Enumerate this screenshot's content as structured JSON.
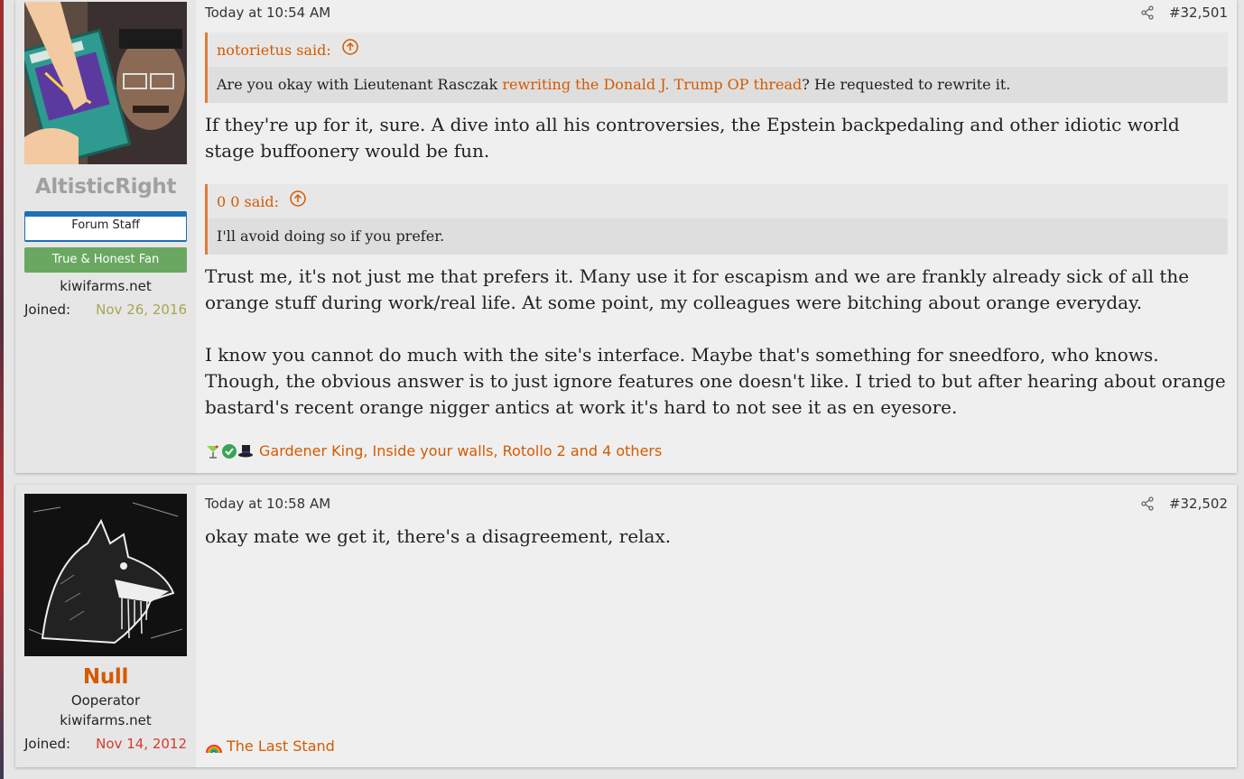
{
  "posts": [
    {
      "username": "AltisticRight",
      "banners": [
        "Forum Staff",
        "True & Honest Fan"
      ],
      "site": "kiwifarms.net",
      "joined_label": "Joined:",
      "joined_date": "Nov 26, 2016",
      "timestamp": "Today at 10:54 AM",
      "post_number": "#32,501",
      "quotes": [
        {
          "author": "notorietus said:",
          "text_before": "Are you okay with Lieutenant Rasczak ",
          "link": "rewriting the Donald J. Trump OP thread",
          "text_after": "? He requested to rewrite it."
        },
        {
          "author": "0 0 said:",
          "text": "I'll avoid doing so if you prefer."
        }
      ],
      "reply1": "If they're up for it, sure. A dive into all his controversies, the Epstein backpedaling and other idiotic world stage buffoonery would be fun.",
      "reply2": "Trust me, it's not just me that prefers it. Many use it for escapism and we are frankly already sick of all the orange stuff during work/real life. At some point, my colleagues were bitching about orange everyday.",
      "reply3": "I know you cannot do much with the site's interface. Maybe that's something for sneedforo, who knows. Though, the obvious answer is to just ignore features one doesn't like. I tried to but after hearing about orange bastard's recent orange nigger antics at work it's hard to not see it as en eyesore.",
      "reactions_text": "Gardener King, Inside your walls, Rotollo 2 and 4 others",
      "reaction_icons": [
        "cocktail-icon",
        "checkmark-icon",
        "top-hat-icon"
      ]
    },
    {
      "username": "Null",
      "title": "Ooperator",
      "site": "kiwifarms.net",
      "joined_label": "Joined:",
      "joined_date": "Nov 14, 2012",
      "timestamp": "Today at 10:58 AM",
      "post_number": "#32,502",
      "message": "okay mate we get it, there's a disagreement, relax.",
      "reactions_text": "The Last Stand",
      "reaction_icons": [
        "rainbow-icon"
      ]
    }
  ],
  "colors": {
    "accent": "#d45a00",
    "staff_border": "#1e6fb3",
    "fan_green": "#6aa862",
    "quote_border": "#e07c3a"
  }
}
